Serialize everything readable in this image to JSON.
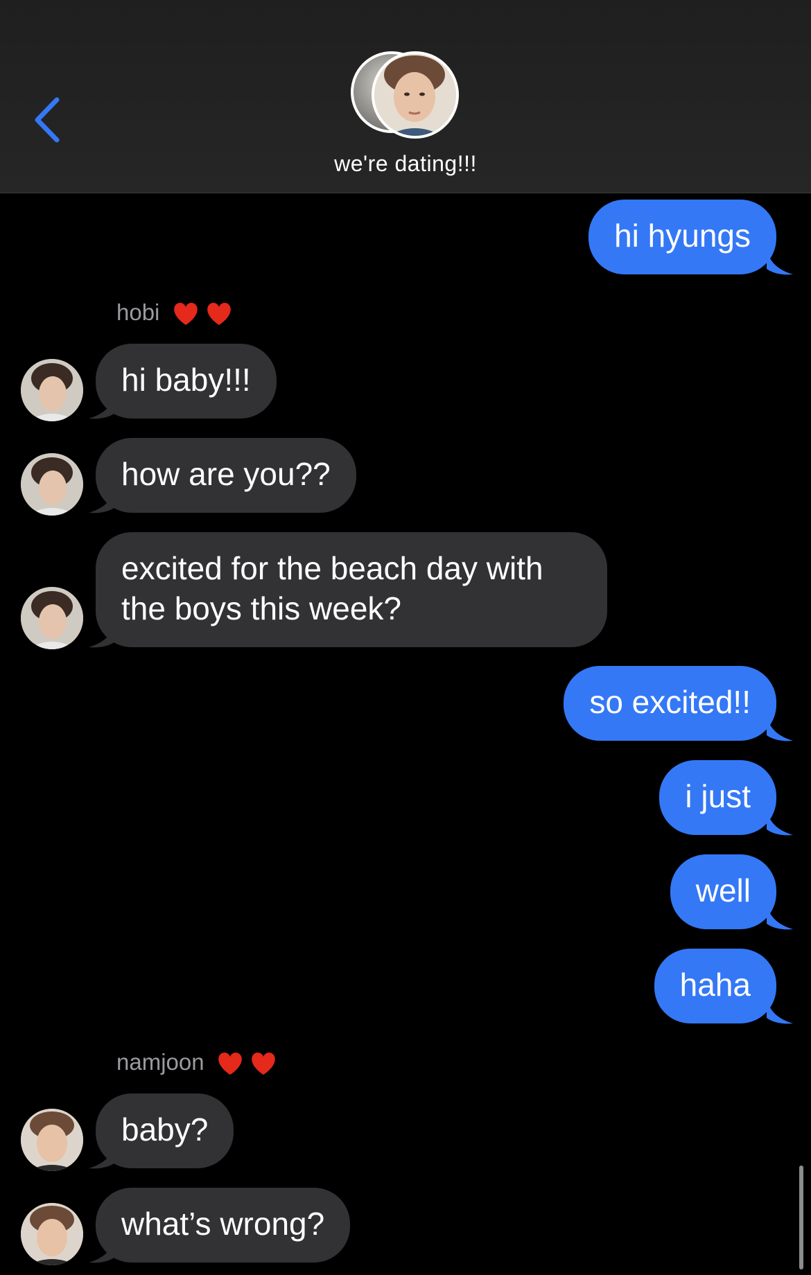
{
  "header": {
    "title": "we're dating!!!",
    "back_icon": "chevron-left-icon",
    "accent": "#3478f6"
  },
  "colors": {
    "sent_bubble": "#3478f6",
    "received_bubble": "#323234",
    "background": "#000000",
    "sender_name": "#9b9b9f"
  },
  "messages": [
    {
      "from": "me",
      "text": "hi hyungs"
    },
    {
      "from": "hobi",
      "sender_label": "hobi",
      "text": "hi baby!!!"
    },
    {
      "from": "hobi",
      "text": "how are you??"
    },
    {
      "from": "hobi",
      "text": "excited for the beach day with the boys this week?"
    },
    {
      "from": "me",
      "text": "so excited!!"
    },
    {
      "from": "me",
      "text": "i just"
    },
    {
      "from": "me",
      "text": "well"
    },
    {
      "from": "me",
      "text": "haha"
    },
    {
      "from": "namjoon",
      "sender_label": "namjoon",
      "text": "baby?"
    },
    {
      "from": "namjoon",
      "text": "what’s wrong?"
    }
  ]
}
